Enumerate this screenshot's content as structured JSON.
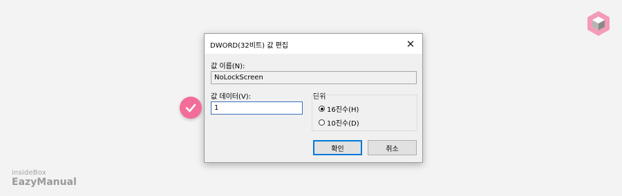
{
  "dialog": {
    "title": "DWORD(32비트) 값 편집",
    "close_glyph": "✕",
    "value_name_label": "값 이름(N):",
    "value_name": "NoLockScreen",
    "value_data_label": "값 데이터(V):",
    "value_data": "1",
    "base_label": "단위",
    "radios": [
      {
        "label": "16진수(H)",
        "selected": true
      },
      {
        "label": "10진수(D)",
        "selected": false
      }
    ],
    "ok_label": "확인",
    "cancel_label": "취소"
  },
  "annotation": {
    "icon": "checkmark-icon",
    "color": "#f26d98"
  },
  "branding": {
    "small_text": "insideBox",
    "large_text": "EazyManual",
    "logo_icon": "cube-icon",
    "logo_color": "#f26d98"
  }
}
